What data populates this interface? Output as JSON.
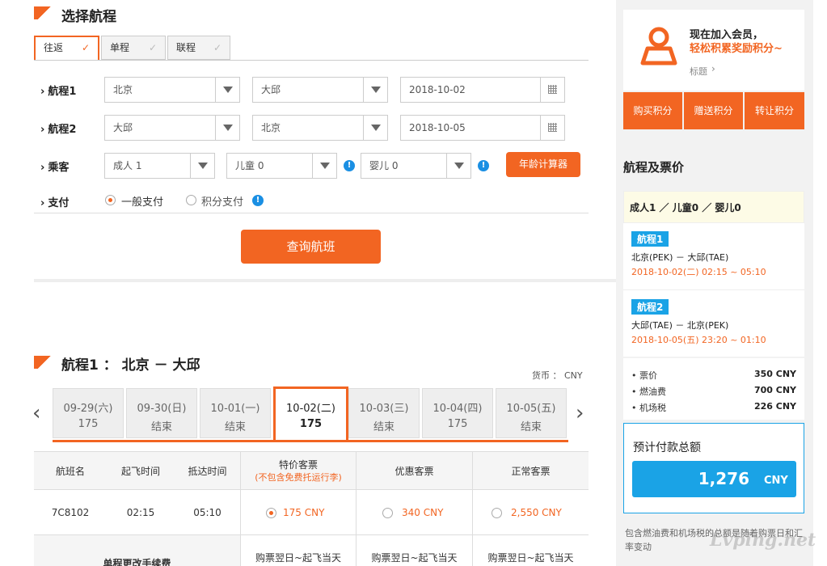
{
  "header": {
    "title": "选择航程"
  },
  "trip_tabs": [
    {
      "label": "往返",
      "active": true
    },
    {
      "label": "单程",
      "active": false
    },
    {
      "label": "联程",
      "active": false
    }
  ],
  "leg1": {
    "label": "航程1",
    "from": "北京",
    "to": "大邱",
    "date": "2018-10-02"
  },
  "leg2": {
    "label": "航程2",
    "from": "大邱",
    "to": "北京",
    "date": "2018-10-05"
  },
  "passengers": {
    "label": "乘客",
    "adult": "成人 1",
    "child": "儿童 0",
    "infant": "婴儿 0",
    "calc_button": "年龄计算器"
  },
  "payment": {
    "label": "支付",
    "opt1": "一般支付",
    "opt2": "积分支付"
  },
  "search_button": "查询航班",
  "results": {
    "title": "航程1 ： 北京 － 大邱",
    "currency": "货币 ： CNY",
    "dates": [
      {
        "date": "09-29(六)",
        "price": "175"
      },
      {
        "date": "09-30(日)",
        "price": "结束"
      },
      {
        "date": "10-01(一)",
        "price": "结束"
      },
      {
        "date": "10-02(二)",
        "price": "175",
        "active": true
      },
      {
        "date": "10-03(三)",
        "price": "结束"
      },
      {
        "date": "10-04(四)",
        "price": "175"
      },
      {
        "date": "10-05(五)",
        "price": "结束"
      }
    ],
    "columns": {
      "flight": "航班名",
      "dep": "起飞时间",
      "arr": "抵达时间",
      "special": "特价客票",
      "special_note": "(不包含免费托运行李)",
      "discount": "优惠客票",
      "normal": "正常客票"
    },
    "row": {
      "flight": "7C8102",
      "dep": "02:15",
      "arr": "05:10",
      "special": "175 CNY",
      "discount": "340 CNY",
      "normal": "2,550 CNY"
    },
    "fee_row": {
      "label": "单程更改手续费",
      "c1": "购票翌日~起飞当天",
      "c2": "购票翌日~起飞当天",
      "c3": "购票翌日~起飞当天"
    }
  },
  "member": {
    "line1": "现在加入会员，",
    "line2": "轻松积累奖励积分~",
    "link": "标题",
    "buttons": [
      "购买积分",
      "赠送积分",
      "转让积分"
    ]
  },
  "summary": {
    "title": "航程及票价",
    "pax": "成人1 ／ 儿童0 ／ 婴儿0",
    "leg1": {
      "tag": "航程1",
      "route": "北京(PEK) － 大邱(TAE)",
      "time": "2018-10-02(二) 02:15 ~ 05:10"
    },
    "leg2": {
      "tag": "航程2",
      "route": "大邱(TAE) － 北京(PEK)",
      "time": "2018-10-05(五) 23:20 ~ 01:10"
    },
    "fees": [
      {
        "name": "票价",
        "value": "350 CNY"
      },
      {
        "name": "燃油费",
        "value": "700 CNY"
      },
      {
        "name": "机场税",
        "value": "226 CNY"
      }
    ],
    "total_label": "预计付款总额",
    "total_value": "1,276",
    "total_unit": "CNY",
    "note": "包含燃油费和机场税的总额是随着购票日和汇率变动"
  },
  "watermark": "Lvping.net",
  "colors": {
    "accent": "#f26522",
    "blue": "#1aa3e6"
  }
}
